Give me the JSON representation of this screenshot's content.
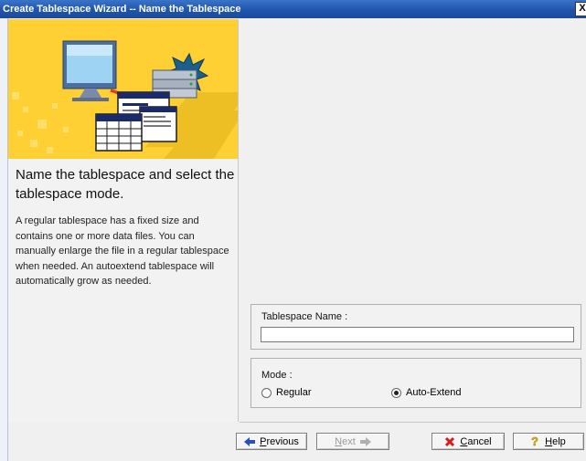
{
  "window": {
    "title": "Create Tablespace Wizard -- Name the Tablespace",
    "close_label": "X"
  },
  "left_panel": {
    "heading": "Name the tablespace and select the tablespace mode.",
    "description": "A regular tablespace has a fixed size and contains one or more data files. You can manually enlarge the file in a regular tablespace when needed. An autoextend tablespace will automatically grow as needed."
  },
  "form": {
    "name_label": "Tablespace Name :",
    "name_value": "",
    "mode_label": "Mode :",
    "mode_options": [
      {
        "label": "Regular",
        "selected": false
      },
      {
        "label": "Auto-Extend",
        "selected": true
      }
    ]
  },
  "buttons": {
    "previous": {
      "mnemonic": "P",
      "rest": "revious"
    },
    "next": {
      "mnemonic": "N",
      "rest": "ext",
      "disabled": true
    },
    "cancel": {
      "mnemonic": "C",
      "rest": "ancel"
    },
    "help": {
      "mnemonic": "H",
      "rest": "elp"
    }
  },
  "colors": {
    "title_bar": "#1f55ad",
    "banner": "#ffd033",
    "cancel_icon": "#d81b1b",
    "arrow_icon": "#2a4fbf"
  }
}
